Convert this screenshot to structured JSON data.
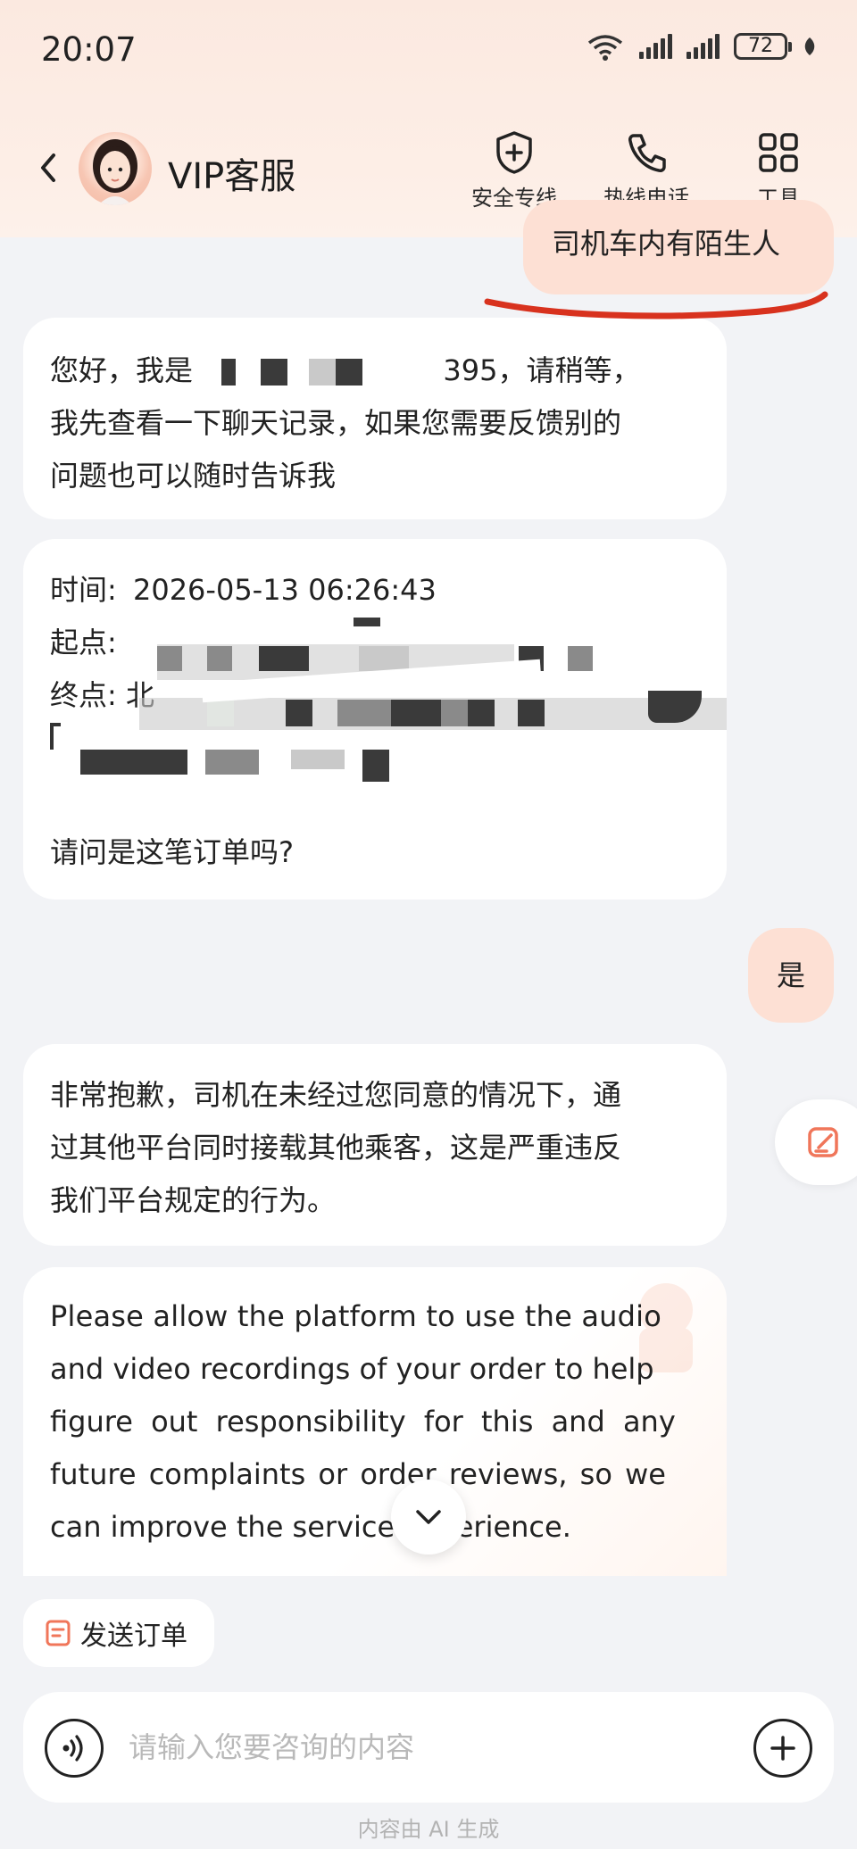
{
  "status_bar": {
    "time": "20:07",
    "battery": "72"
  },
  "header": {
    "title": "VIP客服",
    "tools": [
      {
        "label": "安全专线",
        "icon": "shield-plus-icon"
      },
      {
        "label": "热线电话",
        "icon": "phone-icon"
      },
      {
        "label": "工具",
        "icon": "grid-icon"
      }
    ]
  },
  "messages": {
    "user_1": "司机车内有陌生人",
    "agent_1": {
      "greeting": "您好，我是",
      "agent_id_tail": "395，请稍等，",
      "line2": "我先查看一下聊天记录，如果您需要反馈别的",
      "line3": "问题也可以随时告诉我"
    },
    "order_card": {
      "time_label": "时间:",
      "time_value": "2026-05-13 06:26:43",
      "start_label": "起点:",
      "end_label": "终点:",
      "end_partial": "北",
      "question": "请问是这笔订单吗?"
    },
    "user_2": "是",
    "agent_2": {
      "line1": "非常抱歉，司机在未经过您同意的情况下，通",
      "line2": "过其他平台同时接载其他乘客，这是严重违反",
      "line3": "我们平台规定的行为。"
    },
    "agent_3": {
      "line1": "Please allow the platform to use the audio",
      "line2": "and video recordings of your order to help",
      "line3": "figure out responsibility for this and any",
      "line4": "future complaints or order reviews, so we",
      "line5": "can improve the service experience."
    }
  },
  "actions": {
    "send_order": "发送订单"
  },
  "input": {
    "placeholder": "请输入您要咨询的内容",
    "value": ""
  },
  "footer_note": "内容由 AI 生成",
  "colors": {
    "accent": "#f0765a",
    "user_bubble": "#fde0d4",
    "underline": "#d8321e"
  }
}
